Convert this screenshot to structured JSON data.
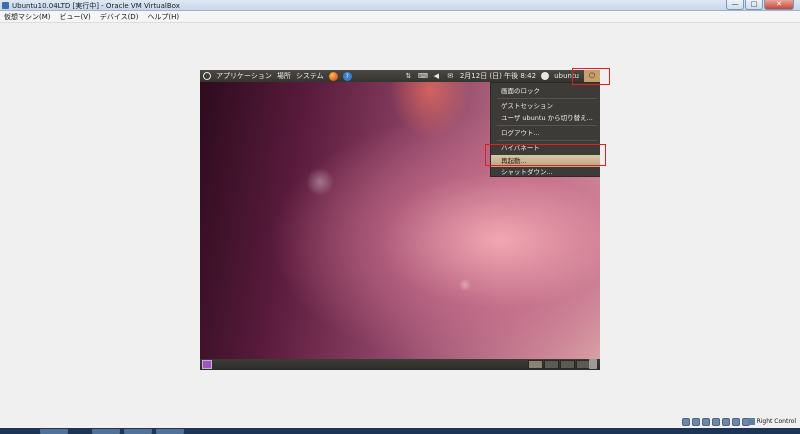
{
  "window": {
    "title": "Ubuntu10.04LTD [実行中] - Oracle VM VirtualBox",
    "controls": {
      "minimize": "—",
      "maximize": "□",
      "close": "✕"
    }
  },
  "menubar": {
    "items": [
      "仮想マシン(M)",
      "ビュー(V)",
      "デバイス(D)",
      "ヘルプ(H)"
    ]
  },
  "guest": {
    "top_panel": {
      "menus": [
        "アプリケーション",
        "場所",
        "システム"
      ],
      "datetime": "2月12日 (日) 午後 8:42",
      "username": "ubuntu",
      "icons": [
        "ubuntu-logo-icon",
        "firefox-icon",
        "help-icon",
        "network-icon",
        "keyboard-icon",
        "volume-icon",
        "mail-icon",
        "user-icon",
        "power-icon"
      ]
    },
    "session_menu": {
      "items": [
        "画面のロック",
        "ゲストセッション",
        "ユーザ ubuntu から切り替え...",
        "ログアウト...",
        "ハイバネート",
        "再起動...",
        "シャットダウン..."
      ],
      "active_item": "再起動..."
    }
  },
  "statusbar": {
    "host_key": "Right Control"
  },
  "colors": {
    "highlight": "#e02020",
    "panel": "#3c3b37",
    "menu_active": "#c8b48f"
  }
}
